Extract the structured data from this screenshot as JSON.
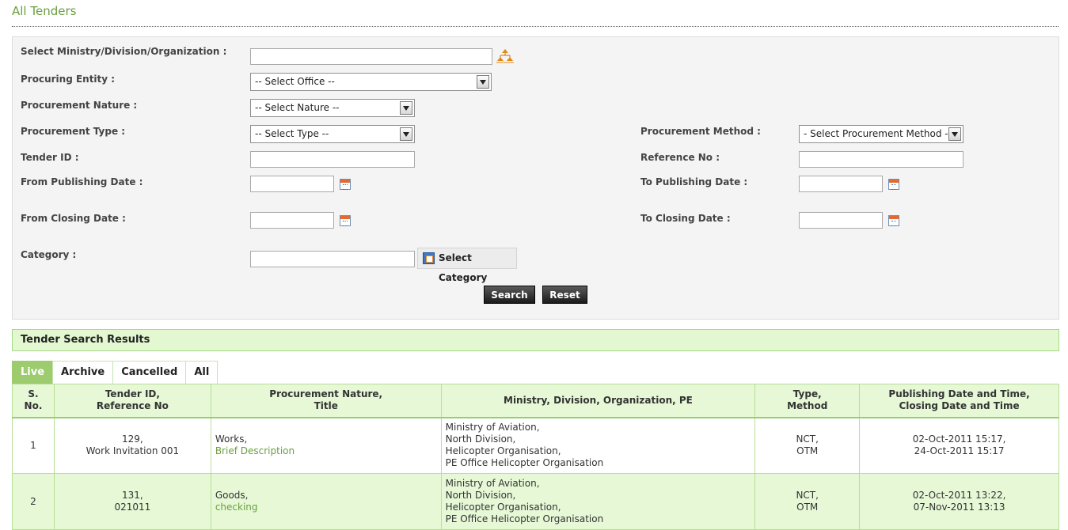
{
  "page": {
    "title": "All Tenders"
  },
  "filters": {
    "ministry_label": "Select Ministry/Division/Organization :",
    "ministry_value": "",
    "procuring_entity_label": "Procuring Entity :",
    "procuring_entity_value": "-- Select Office --",
    "nature_label": "Procurement Nature :",
    "nature_value": "-- Select Nature --",
    "type_label": "Procurement Type :",
    "type_value": "-- Select Type --",
    "method_label": "Procurement Method :",
    "method_value": "- Select Procurement Method -",
    "tender_id_label": "Tender ID :",
    "tender_id_value": "",
    "reference_label": "Reference No :",
    "reference_value": "",
    "from_pub_label": "From Publishing Date :",
    "from_pub_value": "",
    "to_pub_label": "To Publishing Date :",
    "to_pub_value": "",
    "from_close_label": "From Closing Date :",
    "from_close_value": "",
    "to_close_label": "To Closing Date :",
    "to_close_value": "",
    "category_label": "Category :",
    "category_value": "",
    "select_category_label": "Select Category",
    "search_label": "Search",
    "reset_label": "Reset"
  },
  "results": {
    "title": "Tender Search Results",
    "tabs": [
      {
        "label": "Live",
        "active": true
      },
      {
        "label": "Archive",
        "active": false
      },
      {
        "label": "Cancelled",
        "active": false
      },
      {
        "label": "All",
        "active": false
      }
    ],
    "columns": [
      {
        "line1": "S.",
        "line2": "No."
      },
      {
        "line1": "Tender ID,",
        "line2": "Reference No"
      },
      {
        "line1": "Procurement Nature,",
        "line2": "Title"
      },
      {
        "line1": "Ministry, Division, Organization, PE",
        "line2": ""
      },
      {
        "line1": "Type,",
        "line2": "Method"
      },
      {
        "line1": "Publishing Date and Time,",
        "line2": "Closing Date and Time"
      }
    ],
    "rows": [
      {
        "sno": "1",
        "tender_id": "129,",
        "reference": "Work Invitation 001",
        "nature": "Works,",
        "title": "Brief Description",
        "ministry": "Ministry of Aviation,",
        "division": "North Division,",
        "organization": "Helicopter Organisation,",
        "pe": "PE Office Helicopter Organisation",
        "type": "NCT,",
        "method": "OTM",
        "published": "02-Oct-2011 15:17,",
        "closing": "24-Oct-2011 15:17"
      },
      {
        "sno": "2",
        "tender_id": "131,",
        "reference": "021011",
        "nature": "Goods,",
        "title": "checking",
        "ministry": "Ministry of Aviation,",
        "division": "North Division,",
        "organization": "Helicopter Organisation,",
        "pe": "PE Office Helicopter Organisation",
        "type": "NCT,",
        "method": "OTM",
        "published": "02-Oct-2011 13:22,",
        "closing": "07-Nov-2011 13:13"
      }
    ]
  }
}
